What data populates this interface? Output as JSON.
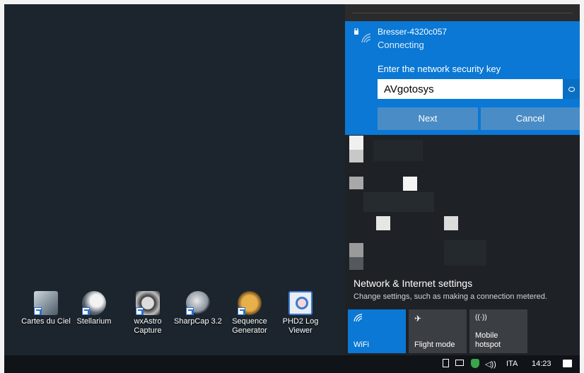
{
  "desktop": {
    "icons": [
      {
        "label": "Cartes du Ciel",
        "icon": "cartes-du-ciel-icon",
        "color": "#7b8793"
      },
      {
        "label": "Stellarium",
        "icon": "stellarium-icon",
        "color": "#9aa5ad"
      },
      {
        "label": "wxAstro Capture",
        "icon": "wxastro-capture-icon",
        "color": "#b9b9b9"
      },
      {
        "label": "SharpCap 3.2",
        "icon": "sharpcap-icon",
        "color": "#8d99a6"
      },
      {
        "label": "Sequence Generator",
        "icon": "sequence-generator-icon",
        "color": "#c88a2c"
      },
      {
        "label": "PHD2 Log Viewer",
        "icon": "phd2-log-viewer-icon",
        "color": "#3b7bd0"
      }
    ]
  },
  "flyout": {
    "network_name": "Bresser-4320c057",
    "status": "Connecting",
    "key_label": "Enter the network security key",
    "key_value": "AVgotosys",
    "next_label": "Next",
    "cancel_label": "Cancel",
    "settings_title": "Network & Internet settings",
    "settings_subtitle": "Change settings, such as making a connection metered.",
    "tiles": {
      "wifi": "WiFi",
      "flight": "Flight mode",
      "hotspot_line1": "Mobile",
      "hotspot_line2": "hotspot"
    },
    "accent_color": "#0a78d4"
  },
  "taskbar": {
    "language": "ITA",
    "time": "14:23"
  }
}
